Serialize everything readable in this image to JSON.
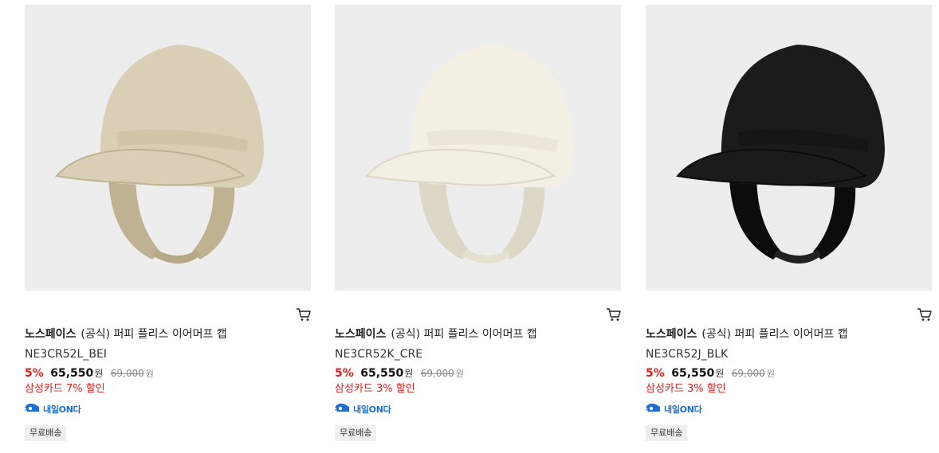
{
  "products": [
    {
      "brand": "노스페이스",
      "name": "(공식) 퍼피 플리스 이어머프 캡",
      "code": "NE3CR52L_BEI",
      "discount_rate": "5%",
      "sale_price": "65,550",
      "currency": "원",
      "original_price": "69,000",
      "card_discount": "삼성카드 7% 할인",
      "delivery_badge": "내일ON다",
      "shipping_tag": "무료배송",
      "cap_color": "#d9cfb6",
      "cap_shade": "#bfb293",
      "strap_color": "#b7a987"
    },
    {
      "brand": "노스페이스",
      "name": "(공식) 퍼피 플리스 이어머프 캡",
      "code": "NE3CR52K_CRE",
      "discount_rate": "5%",
      "sale_price": "65,550",
      "currency": "원",
      "original_price": "69,000",
      "card_discount": "삼성카드 3% 할인",
      "delivery_badge": "내일ON다",
      "shipping_tag": "무료배송",
      "cap_color": "#f3efe4",
      "cap_shade": "#ddd7c7",
      "strap_color": "#e6e0cf"
    },
    {
      "brand": "노스페이스",
      "name": "(공식) 퍼피 플리스 이어머프 캡",
      "code": "NE3CR52J_BLK",
      "discount_rate": "5%",
      "sale_price": "65,550",
      "currency": "원",
      "original_price": "69,000",
      "card_discount": "삼성카드 3% 할인",
      "delivery_badge": "내일ON다",
      "shipping_tag": "무료배송",
      "cap_color": "#1b1b1b",
      "cap_shade": "#0c0c0c",
      "strap_color": "#222222"
    }
  ],
  "icons": {
    "cart": "shopping-cart-icon",
    "delivery": "delivery-truck-icon"
  },
  "colors": {
    "discount_red": "#e02020",
    "delivery_blue": "#1a6fd6",
    "thumb_bg": "#ededed"
  }
}
